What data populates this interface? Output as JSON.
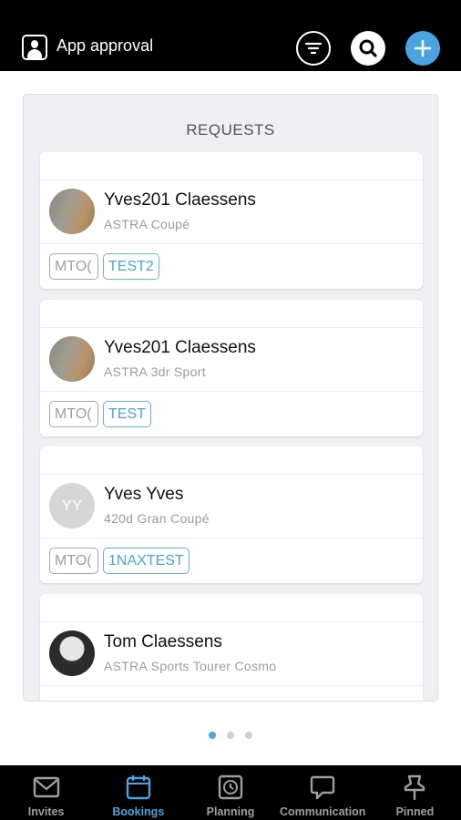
{
  "header": {
    "title": "App approval",
    "app_icon": "contact-card-icon",
    "actions": [
      "filter-icon",
      "search-icon",
      "add-icon"
    ]
  },
  "panel": {
    "title": "REQUESTS"
  },
  "requests": [
    {
      "name": "Yves201 Claessens",
      "vehicle": "ASTRA Coupé",
      "tags": [
        "MTO(",
        "TEST2"
      ],
      "avatar_initials": ""
    },
    {
      "name": "Yves201 Claessens",
      "vehicle": "ASTRA 3dr Sport",
      "tags": [
        "MTO(",
        "TEST"
      ],
      "avatar_initials": ""
    },
    {
      "name": "Yves Yves",
      "vehicle": "420d Gran Coupé",
      "tags": [
        "MTO(",
        "1NAXTEST"
      ],
      "avatar_initials": "YY"
    },
    {
      "name": "Tom Claessens",
      "vehicle": "ASTRA Sports Tourer Cosmo",
      "tags": [],
      "avatar_initials": ""
    }
  ],
  "pagination": {
    "pages": 3,
    "current": 1
  },
  "bottom_nav": [
    {
      "label": "Invites",
      "icon": "mail-icon"
    },
    {
      "label": "Bookings",
      "icon": "calendar-icon"
    },
    {
      "label": "Planning",
      "icon": "clock-calendar-icon"
    },
    {
      "label": "Communication",
      "icon": "chat-bubble-icon"
    },
    {
      "label": "Pinned",
      "icon": "pin-icon"
    }
  ],
  "colors": {
    "accent": "#4aa4df",
    "bar": "#000000",
    "panel_bg": "#efeff4",
    "tag_grey": "#a0a0a0"
  }
}
